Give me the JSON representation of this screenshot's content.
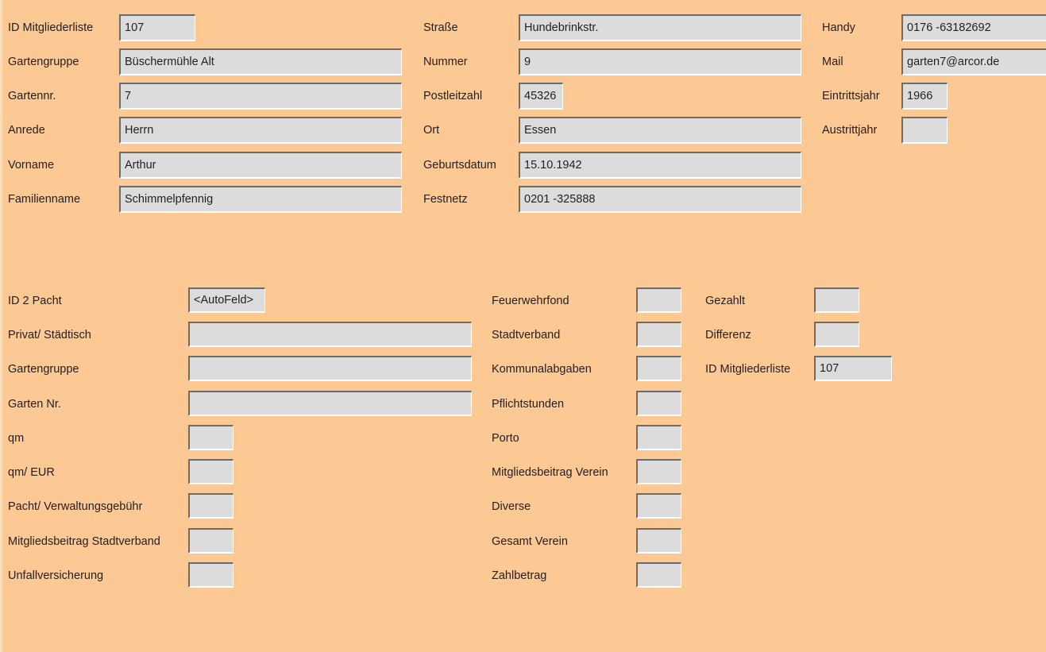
{
  "theme": {
    "background": "#fcc894",
    "field_background": "#dcdcdc",
    "field_border_dark": "#6e6a66",
    "field_border_light": "#ffffff",
    "text_color": "#231f20"
  },
  "member_section": {
    "left_column": [
      {
        "label": "ID Mitgliederliste",
        "value": "107"
      },
      {
        "label": "Gartengruppe",
        "value": "Büschermühle Alt"
      },
      {
        "label": "Gartennr.",
        "value": "7"
      },
      {
        "label": "Anrede",
        "value": "Herrn"
      },
      {
        "label": "Vorname",
        "value": "Arthur"
      },
      {
        "label": "Familienname",
        "value": "Schimmelpfennig"
      }
    ],
    "middle_column": [
      {
        "label": "Straße",
        "value": "Hundebrinkstr."
      },
      {
        "label": "Nummer",
        "value": "9"
      },
      {
        "label": "Postleitzahl",
        "value": "45326"
      },
      {
        "label": "Ort",
        "value": "Essen"
      },
      {
        "label": "Geburtsdatum",
        "value": "15.10.1942"
      },
      {
        "label": "Festnetz",
        "value": "0201 -325888"
      }
    ],
    "right_column": [
      {
        "label": "Handy",
        "value": "0176 -63182692"
      },
      {
        "label": "Mail",
        "value": "garten7@arcor.de"
      },
      {
        "label": "Eintrittsjahr",
        "value": "1966"
      },
      {
        "label": "Austrittjahr",
        "value": ""
      }
    ]
  },
  "lease_section": {
    "left_column": [
      {
        "label": "ID 2 Pacht",
        "value": "<AutoFeld>"
      },
      {
        "label": "Privat/ Städtisch",
        "value": ""
      },
      {
        "label": "Gartengruppe",
        "value": ""
      },
      {
        "label": "Garten Nr.",
        "value": ""
      },
      {
        "label": "qm",
        "value": ""
      },
      {
        "label": "qm/ EUR",
        "value": ""
      },
      {
        "label": "Pacht/ Verwaltungsgebühr",
        "value": ""
      },
      {
        "label": "Mitgliedsbeitrag Stadtverband",
        "value": ""
      },
      {
        "label": "Unfallversicherung",
        "value": ""
      }
    ],
    "middle_column": [
      {
        "label": "Feuerwehrfond",
        "value": ""
      },
      {
        "label": "Stadtverband",
        "value": ""
      },
      {
        "label": "Kommunalabgaben",
        "value": ""
      },
      {
        "label": "Pflichtstunden",
        "value": ""
      },
      {
        "label": "Porto",
        "value": ""
      },
      {
        "label": "Mitgliedsbeitrag Verein",
        "value": ""
      },
      {
        "label": "Diverse",
        "value": ""
      },
      {
        "label": "Gesamt Verein",
        "value": ""
      },
      {
        "label": "Zahlbetrag",
        "value": ""
      }
    ],
    "right_column": [
      {
        "label": "Gezahlt",
        "value": ""
      },
      {
        "label": "Differenz",
        "value": ""
      },
      {
        "label": "ID Mitgliederliste",
        "value": "107"
      }
    ]
  }
}
